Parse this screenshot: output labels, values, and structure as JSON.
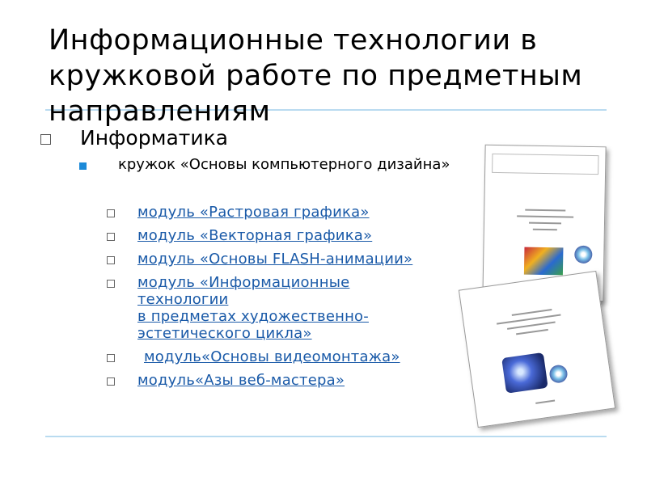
{
  "title": "Информационные технологии в кружковой работе по предметным направлениям",
  "level1": {
    "label": "Информатика"
  },
  "level2": {
    "label": "кружок «Основы компьютерного дизайна»"
  },
  "links": [
    "модуль «Растровая графика»",
    "модуль «Векторная графика»",
    "модуль «Основы  FLASH-анимации»",
    "модуль «Информационные\nтехнологии\nв предметах художественно-\nэстетического цикла»",
    "модуль«Основы  видеомонтажа»",
    "модуль«Азы веб-мастера»"
  ],
  "colors": {
    "rule": "#b9dbf0",
    "bullet": "#1c8ad8",
    "link": "#1a5aa8"
  }
}
